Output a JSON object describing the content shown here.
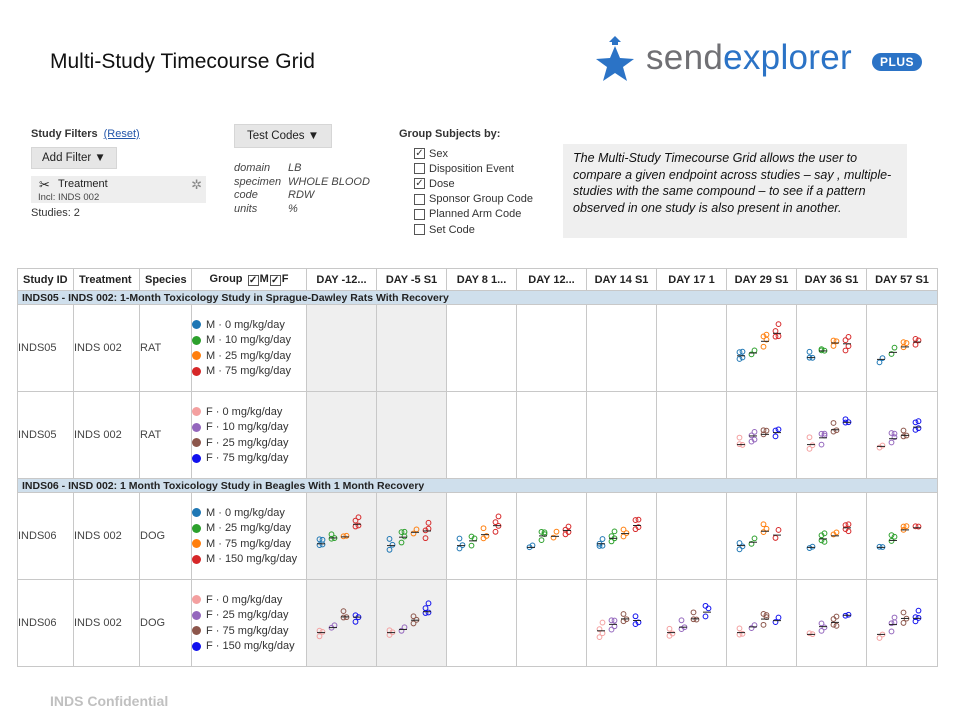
{
  "title": "Multi-Study Timecourse Grid",
  "logo": {
    "word_a": "send",
    "word_b": "explorer",
    "badge": "PLUS",
    "icon": "star-person-icon",
    "accent": "#2b73c6",
    "gray": "#707074"
  },
  "filters": {
    "header": "Study Filters",
    "reset": "(Reset)",
    "add_filter": "Add Filter ▼",
    "chip": {
      "name": "Treatment",
      "include": "Incl: INDS 002",
      "remove_icon": "scissors-icon",
      "settings_icon": "gear-icon"
    },
    "studies": "Studies: 2"
  },
  "tests": {
    "button": "Test Codes ▼",
    "rows": [
      {
        "k": "domain",
        "v": "LB"
      },
      {
        "k": "specimen",
        "v": "WHOLE BLOOD"
      },
      {
        "k": "code",
        "v": "RDW"
      },
      {
        "k": "units",
        "v": "%"
      }
    ]
  },
  "groupby": {
    "header": "Group Subjects by:",
    "options": [
      {
        "label": "Sex",
        "checked": true
      },
      {
        "label": "Disposition Event",
        "checked": false
      },
      {
        "label": "Dose",
        "checked": true
      },
      {
        "label": "Sponsor Group Code",
        "checked": false
      },
      {
        "label": "Planned Arm Code",
        "checked": false
      },
      {
        "label": "Set Code",
        "checked": false
      }
    ]
  },
  "note": "The Multi-Study Timecourse Grid allows the user to compare a given endpoint across studies – say , multiple-studies with the same compound – to see if a pattern observed in one study is also present in another.",
  "grid": {
    "headers": {
      "study_id": "Study ID",
      "treatment": "Treatment",
      "species": "Species",
      "group": "Group",
      "m": "M",
      "f": "F",
      "days": [
        "DAY -12...",
        "DAY -5 S1",
        "DAY 8 1...",
        "DAY 12...",
        "DAY 14 S1",
        "DAY 17 1",
        "DAY 29 S1",
        "DAY 36 S1",
        "DAY 57 S1"
      ]
    },
    "bands": [
      "INDS05 - INDS 002: 1-Month Toxicology Study in Sprague-Dawley Rats With Recovery",
      "INDS06 - INSD 002: 1 Month Toxicology Study in Beagles With 1 Month Recovery"
    ],
    "rows": [
      {
        "study": "INDS05",
        "treatment": "INDS 002",
        "species": "RAT",
        "band": 0,
        "groups": [
          {
            "label": "M · 0 mg/kg/day",
            "color": "#1f77b4"
          },
          {
            "label": "M · 10 mg/kg/day",
            "color": "#2ca02c"
          },
          {
            "label": "M · 25 mg/kg/day",
            "color": "#ff7f0e"
          },
          {
            "label": "M · 75 mg/kg/day",
            "color": "#d62728"
          }
        ]
      },
      {
        "study": "INDS05",
        "treatment": "INDS 002",
        "species": "RAT",
        "band": null,
        "groups": [
          {
            "label": "F · 0 mg/kg/day",
            "color": "#f4a0a0"
          },
          {
            "label": "F · 10 mg/kg/day",
            "color": "#9467bd"
          },
          {
            "label": "F · 25 mg/kg/day",
            "color": "#8c564b"
          },
          {
            "label": "F · 75 mg/kg/day",
            "color": "#1010ee"
          }
        ]
      },
      {
        "study": "INDS06",
        "treatment": "INDS 002",
        "species": "DOG",
        "band": 1,
        "groups": [
          {
            "label": "M · 0 mg/kg/day",
            "color": "#1f77b4"
          },
          {
            "label": "M · 25 mg/kg/day",
            "color": "#2ca02c"
          },
          {
            "label": "M · 75 mg/kg/day",
            "color": "#ff7f0e"
          },
          {
            "label": "M · 150 mg/kg/day",
            "color": "#d62728"
          }
        ]
      },
      {
        "study": "INDS06",
        "treatment": "INDS 002",
        "species": "DOG",
        "band": null,
        "groups": [
          {
            "label": "F · 0 mg/kg/day",
            "color": "#f4a0a0"
          },
          {
            "label": "F · 25 mg/kg/day",
            "color": "#9467bd"
          },
          {
            "label": "F · 75 mg/kg/day",
            "color": "#8c564b"
          },
          {
            "label": "F · 150 mg/kg/day",
            "color": "#1010ee"
          }
        ]
      }
    ]
  },
  "confidential": "INDS Confidential"
}
